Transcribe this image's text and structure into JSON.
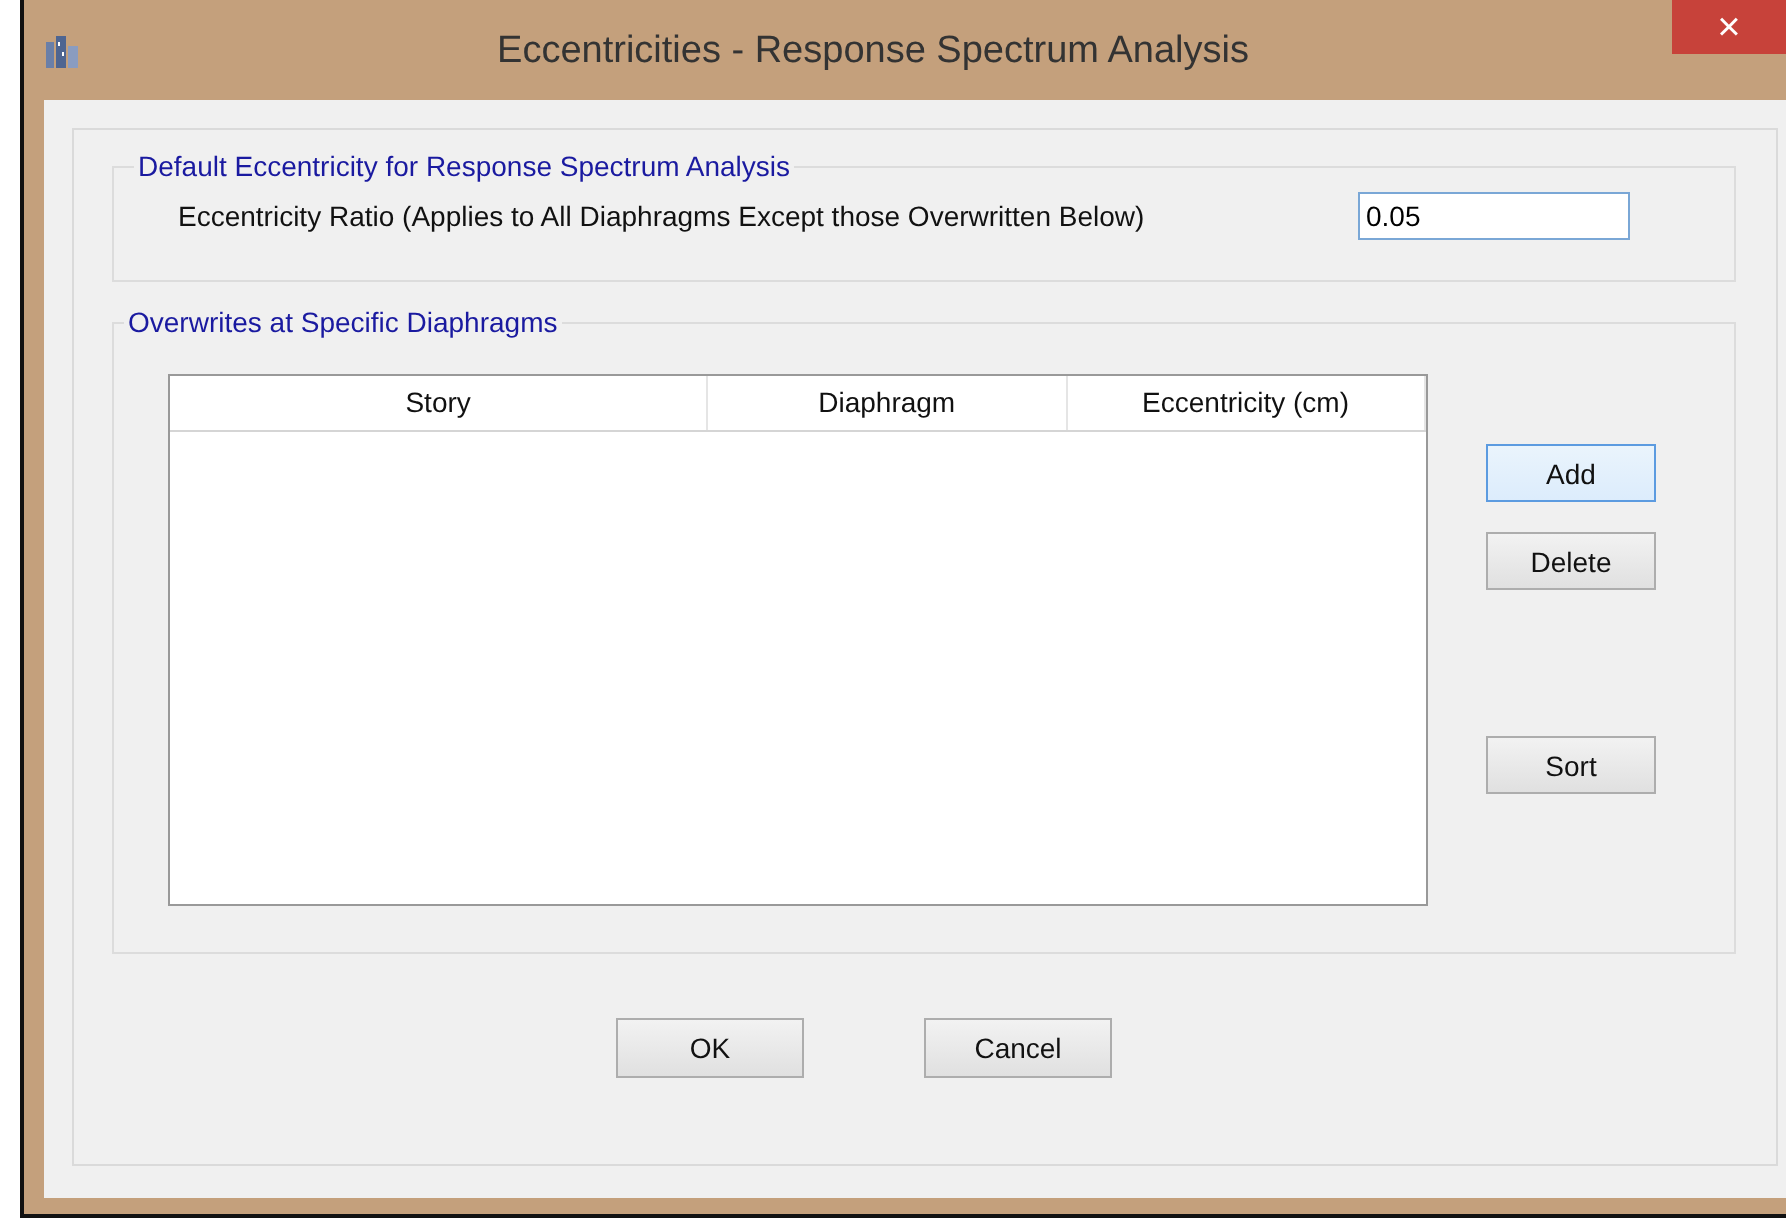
{
  "window": {
    "title": "Eccentricities - Response Spectrum Analysis",
    "close": "×"
  },
  "default_group": {
    "title": "Default Eccentricity for Response Spectrum Analysis",
    "label": "Eccentricity Ratio (Applies to All Diaphragms Except those Overwritten Below)",
    "value": "0.05"
  },
  "overwrites_group": {
    "title": "Overwrites at Specific Diaphragms",
    "table": {
      "columns": [
        "Story",
        "Diaphragm",
        "Eccentricity (cm)"
      ]
    },
    "buttons": [
      {
        "label": "Add",
        "highlighted": true
      },
      {
        "label": "Delete",
        "highlighted": false
      },
      {
        "label": "Sort",
        "highlighted": false
      }
    ]
  },
  "buttons": [
    {
      "label": "OK",
      "highlighted": false
    },
    {
      "label": "Cancel",
      "highlighted": false
    }
  ]
}
